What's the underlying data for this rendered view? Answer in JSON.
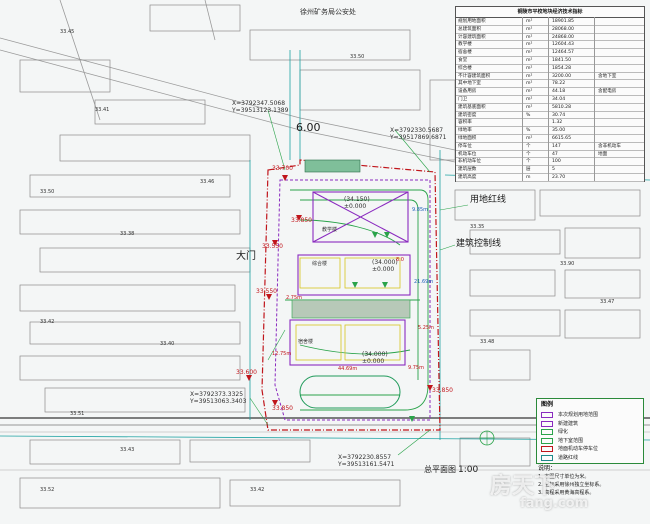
{
  "plan": {
    "gate_label": "大门",
    "redline_label": "用地红线",
    "setback_label": "建筑控制线",
    "scale_title": "总平面图",
    "scale_ratio": "1:00",
    "road_width": "6.00",
    "bureau_label": "徐州矿务局公安处",
    "coords": [
      {
        "x": "X=3792347.5068",
        "y": "Y=39513123.1389"
      },
      {
        "x": "X=3792330.5687",
        "y": "Y=39517869.6871"
      },
      {
        "x": "X=3792373.3325",
        "y": "Y=39513063.3403"
      },
      {
        "x": "X=3792230.8557",
        "y": "Y=39513161.5471"
      }
    ],
    "buildings": [
      {
        "elev": "(34.150)",
        "zero": "±0.000",
        "name": "教学楼"
      },
      {
        "elev": "(34.000)",
        "zero": "±0.000",
        "name": "综合楼"
      },
      {
        "elev": "(34.000)",
        "zero": "±0.000",
        "name": "宿舍楼"
      }
    ],
    "spot_levels": [
      "33.700",
      "33.850",
      "33.550",
      "33.550",
      "33.600",
      "33.850",
      "33.850"
    ],
    "dims": [
      "9.85m",
      "21.69m",
      "44.69m",
      "9.75m",
      "12.75m",
      "5.25m",
      "2.75m",
      "8.0"
    ],
    "grid_values": [
      "33.45",
      "33.41",
      "33.50",
      "33.38",
      "33.42",
      "33.40",
      "33.51",
      "33.46",
      "33.50",
      "33.35",
      "33.90",
      "33.48",
      "33.47",
      "33.43",
      "33.42",
      "33.52"
    ]
  },
  "table": {
    "title": "铜陵市平校地块经济技术指标",
    "rows": [
      [
        "规划用地面积",
        "m²",
        "18901.85",
        ""
      ],
      [
        "总建筑面积",
        "m²",
        "28068.00",
        ""
      ],
      [
        "计容建筑面积",
        "m²",
        "24868.00",
        ""
      ],
      [
        "教学楼",
        "m²",
        "12604.43",
        ""
      ],
      [
        "宿舍楼",
        "m²",
        "12464.57",
        ""
      ],
      [
        "食堂",
        "m²",
        "1841.50",
        ""
      ],
      [
        "综合楼",
        "m²",
        "1854.28",
        ""
      ],
      [
        "不计容建筑面积",
        "m²",
        "3200.00",
        "含地下室"
      ],
      [
        "其中地下室",
        "m²",
        "78.22",
        ""
      ],
      [
        "设备用房",
        "m²",
        "44.18",
        "含配电房"
      ],
      [
        "门卫",
        "m²",
        "34.04",
        ""
      ],
      [
        "建筑基底面积",
        "m²",
        "5810.28",
        ""
      ],
      [
        "建筑密度",
        "%",
        "30.74",
        ""
      ],
      [
        "容积率",
        "",
        "1.32",
        ""
      ],
      [
        "绿地率",
        "%",
        "35.00",
        ""
      ],
      [
        "绿地面积",
        "m²",
        "6615.65",
        ""
      ],
      [
        "停车位",
        "个",
        "147",
        "含非机动车"
      ],
      [
        "机动车位",
        "个",
        "47",
        "地面"
      ],
      [
        "非机动车位",
        "个",
        "100",
        ""
      ],
      [
        "建筑层数",
        "层",
        "5",
        ""
      ],
      [
        "建筑高度",
        "m",
        "23.70",
        ""
      ]
    ]
  },
  "legend": {
    "title": "图例",
    "items": [
      {
        "label": "本次规划用地范围",
        "color": "#8a2bbf"
      },
      {
        "label": "新建建筑",
        "color": "#8a2bbf"
      },
      {
        "label": "绿化",
        "color": "#2aa34a"
      },
      {
        "label": "地下室范围",
        "color": "#2aa34a"
      },
      {
        "label": "地面机动车停车位",
        "color": "#c0151b"
      },
      {
        "label": "道路红线",
        "color": "#1f8a8a"
      }
    ]
  },
  "notes": {
    "title": "说明：",
    "lines": [
      "1. 本图尺寸单位为米。",
      "2. 坐标采用徐州独立坐标系。",
      "3. 高程采用黄海高程系。"
    ]
  },
  "watermark": {
    "line1": "房天下",
    "line2": "fang.com"
  }
}
